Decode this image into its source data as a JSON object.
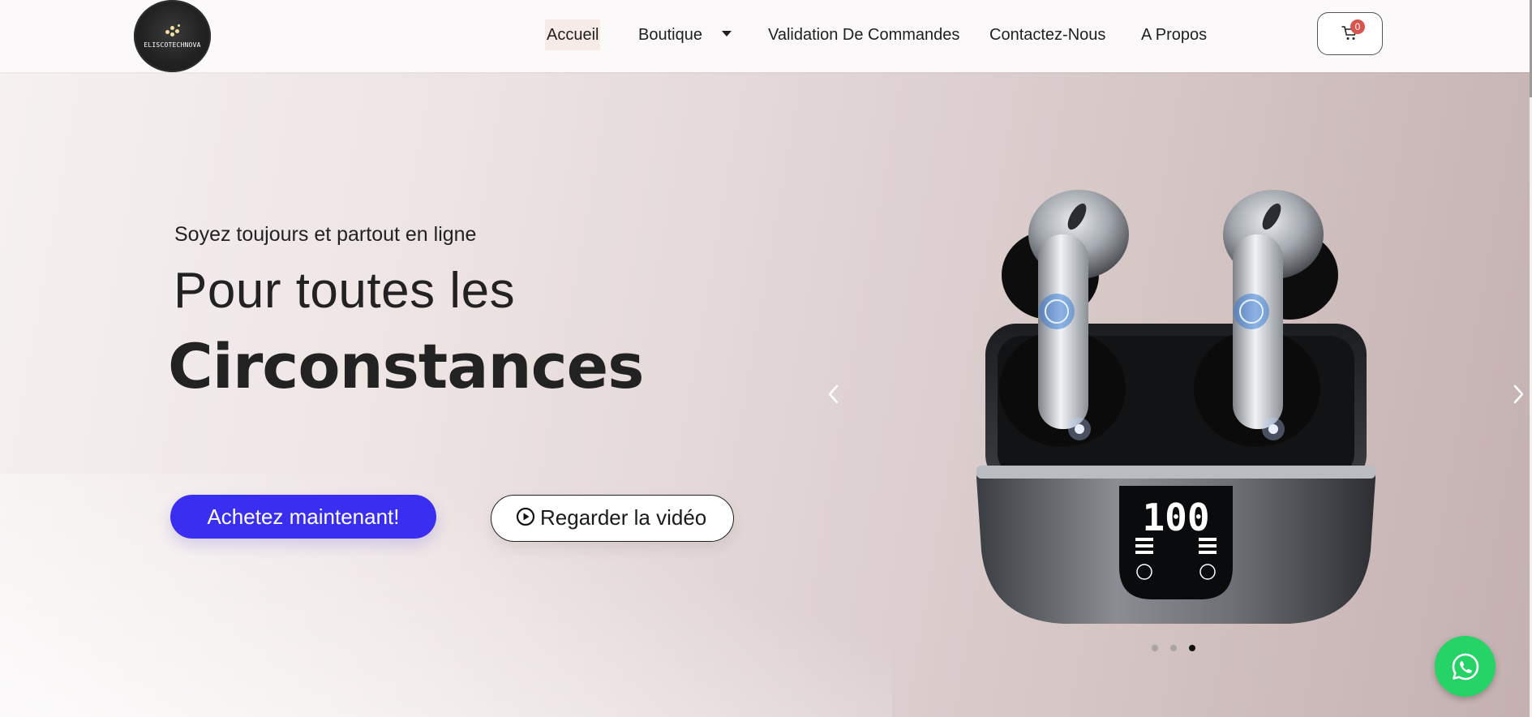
{
  "brand": {
    "logo_text": "ELISCOTECHNOVA"
  },
  "nav": {
    "items": [
      {
        "label": "Accueil",
        "active": true
      },
      {
        "label": "Boutique",
        "has_dropdown": true
      },
      {
        "label": "Validation De Commandes"
      },
      {
        "label": "Contactez-Nous"
      },
      {
        "label": "A Propos"
      }
    ]
  },
  "cart": {
    "count": "0",
    "icon": "cart-icon",
    "badge_color": "#d9534f"
  },
  "hero": {
    "tagline": "Soyez toujours et partout en ligne",
    "headline_light": "Pour toutes les",
    "headline_bold": "Circonstances",
    "cta_primary": "Achetez maintenant!",
    "cta_secondary": "Regarder la vidéo",
    "cta_primary_color": "#3a2ff0",
    "slider": {
      "slide_count": 3,
      "active_slide": 3
    }
  },
  "floating": {
    "whatsapp_icon": "whatsapp-icon",
    "whatsapp_color": "#25d366"
  }
}
